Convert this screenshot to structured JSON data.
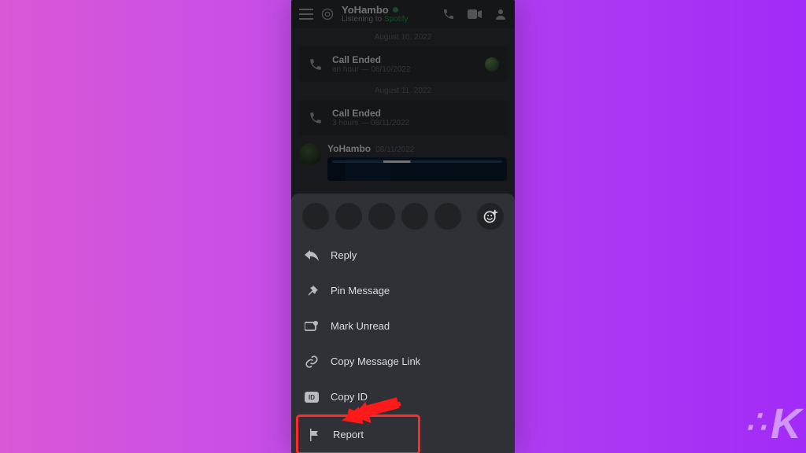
{
  "header": {
    "username": "YoHambo",
    "substatus_prefix": "Listening to ",
    "substatus_app": "Spotify"
  },
  "dates": {
    "d1": "August 10, 2022",
    "d2": "August 11, 2022"
  },
  "calls": [
    {
      "title": "Call Ended",
      "sub": "an hour — 08/10/2022"
    },
    {
      "title": "Call Ended",
      "sub": "3 hours — 08/11/2022"
    }
  ],
  "message": {
    "user": "YoHambo",
    "time": "08/11/2022"
  },
  "actions": {
    "reply": "Reply",
    "pin": "Pin Message",
    "unread": "Mark Unread",
    "copy_link": "Copy Message Link",
    "copy_id": "Copy ID",
    "report": "Report"
  },
  "watermark": "K"
}
